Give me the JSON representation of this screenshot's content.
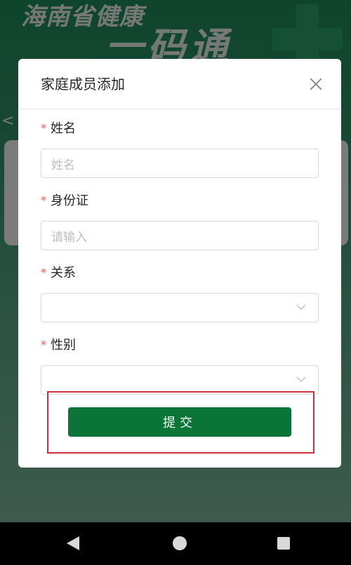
{
  "background": {
    "banner_title": "海南省健康",
    "banner_subtitle": "一码通",
    "back_glyph": "<"
  },
  "modal": {
    "title": "家庭成员添加",
    "close_icon": "close-icon",
    "fields": [
      {
        "label": "姓名",
        "required": true,
        "type": "text",
        "placeholder": "姓名",
        "value": ""
      },
      {
        "label": "身份证",
        "required": true,
        "type": "text",
        "placeholder": "请输入",
        "value": ""
      },
      {
        "label": "关系",
        "required": true,
        "type": "select",
        "placeholder": "",
        "value": ""
      },
      {
        "label": "性别",
        "required": true,
        "type": "select",
        "placeholder": "",
        "value": ""
      }
    ],
    "required_mark": "*",
    "submit_label": "提交"
  },
  "colors": {
    "primary": "#0b7437",
    "required": "#ff4d4f",
    "highlight": "#d32f3a"
  },
  "navbar": {
    "back_icon": "nav-back-icon",
    "home_icon": "nav-home-icon",
    "recent_icon": "nav-recent-apps-icon"
  }
}
